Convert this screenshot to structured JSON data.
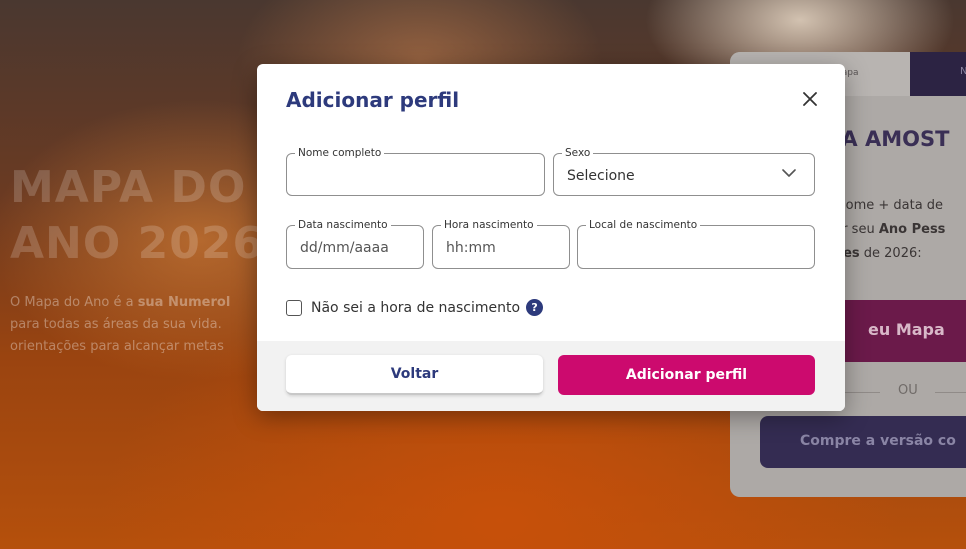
{
  "background": {
    "hero_title": "MAPA DO\nANO 2026",
    "hero_text_pre": "O Mapa do Ano é a ",
    "hero_text_bold": "sua Numerol",
    "hero_text_post": " para todas as áreas da sua vida. orientações para alcançar metas",
    "side_tab1": "Mapa",
    "side_tab2": "N",
    "side_heading": "UA AMOST\nS",
    "side_body_1": "u nome + data de",
    "side_body_2": "brir seu ",
    "side_body_2_bold": "Ano Pess",
    "side_body_3_bold": "ades",
    "side_body_3": " de 2026:",
    "side_cta": "eu Mapa",
    "side_ou": "OU",
    "side_buy": "Compre a versão co"
  },
  "modal": {
    "title": "Adicionar perfil",
    "close_icon": "close-icon",
    "fields": {
      "full_name": {
        "label": "Nome completo",
        "value": ""
      },
      "sex": {
        "label": "Sexo",
        "value": "Selecione"
      },
      "birth_date": {
        "label": "Data nascimento",
        "placeholder": "dd/mm/aaaa"
      },
      "birth_time": {
        "label": "Hora nascimento",
        "placeholder": "hh:mm"
      },
      "birth_place": {
        "label": "Local de nascimento",
        "value": ""
      }
    },
    "unknown_time_label": "Não sei a hora de nascimento",
    "help_icon": "?",
    "back_button": "Voltar",
    "add_button": "Adicionar perfil"
  },
  "colors": {
    "title": "#2d3a7c",
    "primary_button": "#cc0a6e",
    "footer_bg": "#f2f2f2"
  }
}
